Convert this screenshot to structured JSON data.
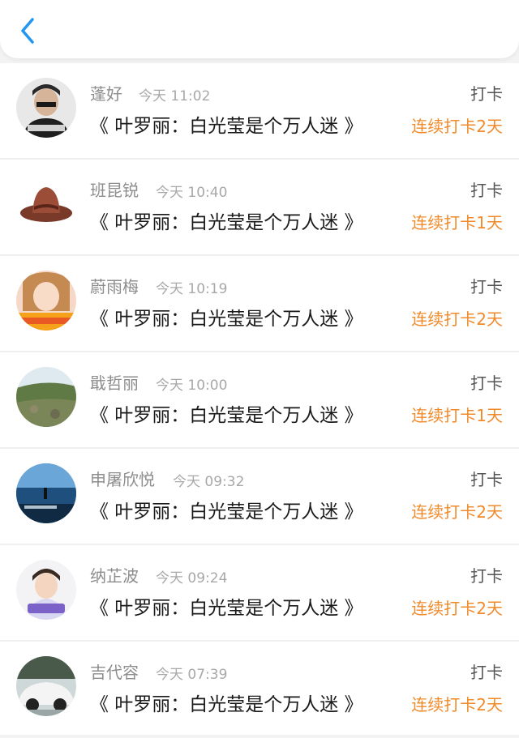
{
  "header": {
    "back_icon": "chevron-left-icon",
    "accent_color": "#2196f3"
  },
  "colors": {
    "streak": "#f08a2a",
    "name": "#8d8d8d",
    "time": "#a8a8a8"
  },
  "records": [
    {
      "user": "蓬好",
      "time": "今天 11:02",
      "title": "《 叶罗丽：白光莹是个万人迷 》",
      "action": "打卡",
      "streak": "连续打卡2天"
    },
    {
      "user": "班昆锐",
      "time": "今天 10:40",
      "title": "《 叶罗丽：白光莹是个万人迷 》",
      "action": "打卡",
      "streak": "连续打卡1天"
    },
    {
      "user": "蔚雨梅",
      "time": "今天 10:19",
      "title": "《 叶罗丽：白光莹是个万人迷 》",
      "action": "打卡",
      "streak": "连续打卡2天"
    },
    {
      "user": "戢哲丽",
      "time": "今天 10:00",
      "title": "《 叶罗丽：白光莹是个万人迷 》",
      "action": "打卡",
      "streak": "连续打卡1天"
    },
    {
      "user": "申屠欣悦",
      "time": "今天 09:32",
      "title": "《 叶罗丽：白光莹是个万人迷 》",
      "action": "打卡",
      "streak": "连续打卡2天"
    },
    {
      "user": "纳芷波",
      "time": "今天 09:24",
      "title": "《 叶罗丽：白光莹是个万人迷 》",
      "action": "打卡",
      "streak": "连续打卡2天"
    },
    {
      "user": "吉代容",
      "time": "今天 07:39",
      "title": "《 叶罗丽：白光莹是个万人迷 》",
      "action": "打卡",
      "streak": "连续打卡2天"
    }
  ]
}
